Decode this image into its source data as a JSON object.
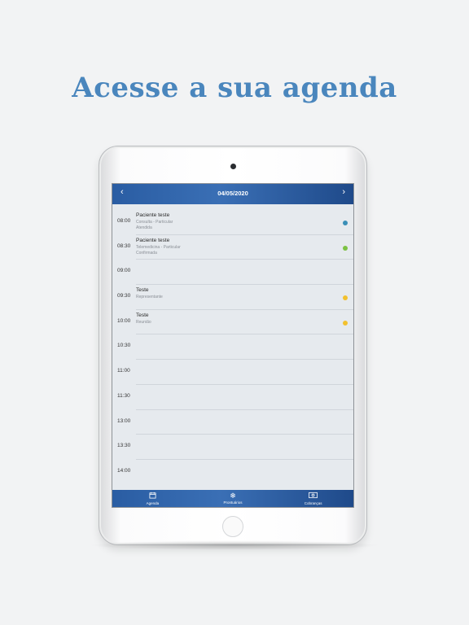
{
  "headline": "Acesse a sua agenda",
  "header": {
    "date": "04/05/2020",
    "prev_icon": "chevron-left-icon",
    "next_icon": "chevron-right-icon"
  },
  "slots": [
    {
      "time": "08:00",
      "title": "Paciente teste",
      "line1": "Consulta - Particular",
      "line2": "Atendida",
      "status_color": "#3a8fb7"
    },
    {
      "time": "08:30",
      "title": "Paciente teste",
      "line1": "Telemedicina - Particular",
      "line2": "Confirmada",
      "status_color": "#7cc243"
    },
    {
      "time": "09:00"
    },
    {
      "time": "09:30",
      "title": "Teste",
      "line1": "Representante",
      "status_color": "#f2c12e"
    },
    {
      "time": "10:00",
      "title": "Teste",
      "line1": "Reunião",
      "status_color": "#f2c12e"
    },
    {
      "time": "10:30"
    },
    {
      "time": "11:00"
    },
    {
      "time": "11:30"
    },
    {
      "time": "13:00"
    },
    {
      "time": "13:30"
    },
    {
      "time": "14:00"
    }
  ],
  "tabs": [
    {
      "label": "Agenda",
      "icon": "calendar-icon"
    },
    {
      "label": "Prontuários",
      "icon": "snowflake-icon"
    },
    {
      "label": "Cobranças",
      "icon": "money-icon"
    }
  ]
}
